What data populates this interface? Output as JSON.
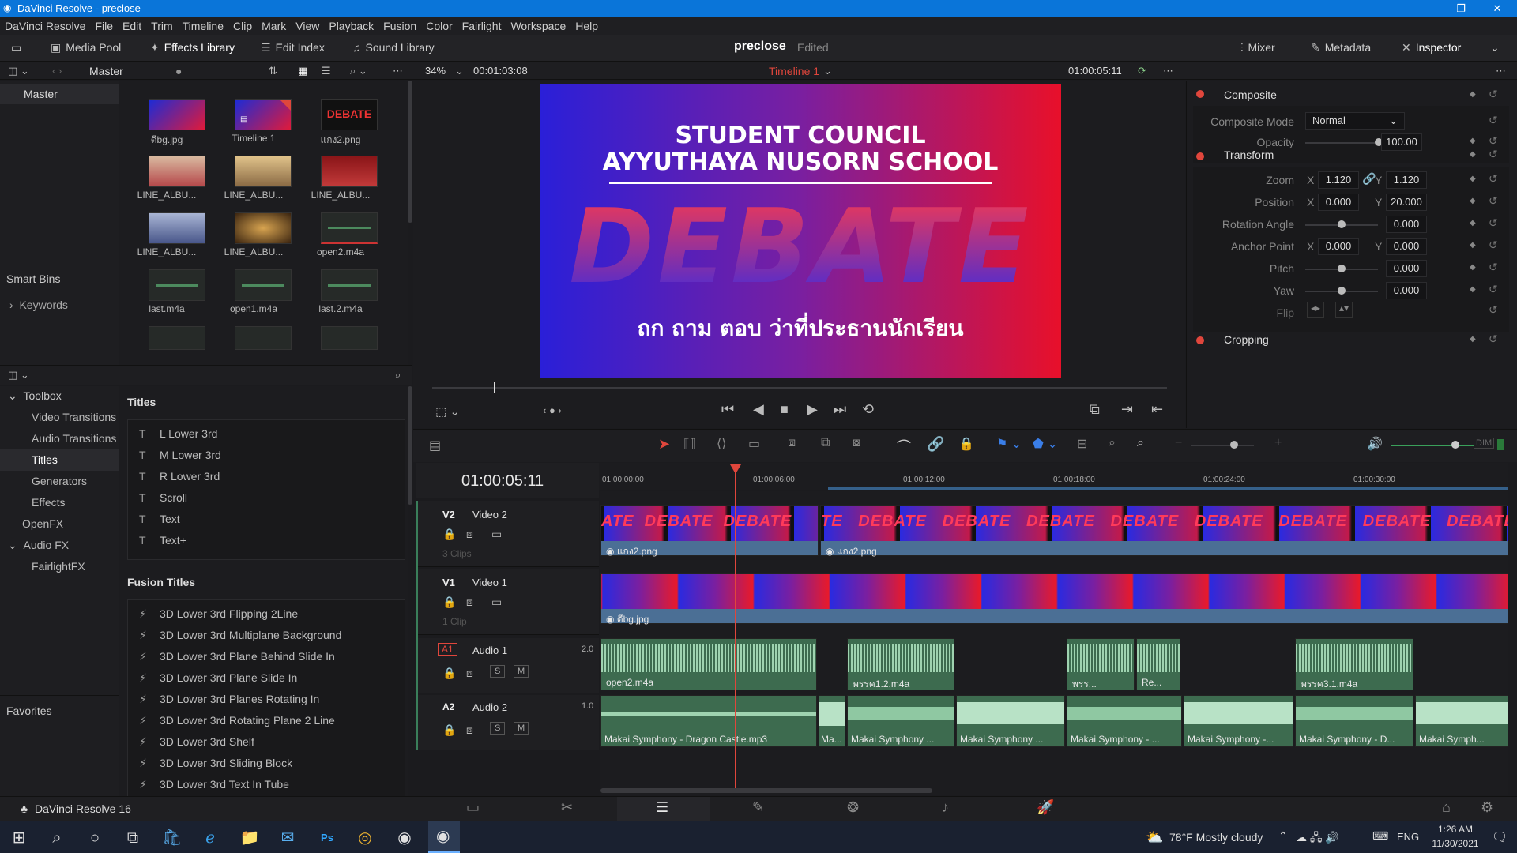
{
  "window": {
    "title": "DaVinci Resolve - preclose",
    "minimize": "—",
    "maximize": "❐",
    "close": "✕"
  },
  "menu": [
    "DaVinci Resolve",
    "File",
    "Edit",
    "Trim",
    "Timeline",
    "Clip",
    "Mark",
    "View",
    "Playback",
    "Fusion",
    "Color",
    "Fairlight",
    "Workspace",
    "Help"
  ],
  "toolbar": {
    "media_pool": "Media Pool",
    "effects_library": "Effects Library",
    "edit_index": "Edit Index",
    "sound_library": "Sound Library",
    "project_name": "preclose",
    "project_status": "Edited",
    "mixer": "Mixer",
    "metadata": "Metadata",
    "inspector": "Inspector"
  },
  "media_pool": {
    "bin": "Master",
    "tree_master": "Master",
    "smart_bins": "Smart Bins",
    "keywords": "Keywords",
    "clips": [
      {
        "name": "ดีbg.jpg"
      },
      {
        "name": "Timeline 1"
      },
      {
        "name": "แกง2.png"
      },
      {
        "name": "LINE_ALBU..."
      },
      {
        "name": "LINE_ALBU..."
      },
      {
        "name": "LINE_ALBU..."
      },
      {
        "name": "LINE_ALBU..."
      },
      {
        "name": "LINE_ALBU..."
      },
      {
        "name": "open2.m4a"
      },
      {
        "name": "last.m4a"
      },
      {
        "name": "open1.m4a"
      },
      {
        "name": "last.2.m4a"
      }
    ]
  },
  "effects": {
    "toolbox": "Toolbox",
    "tree": [
      "Video Transitions",
      "Audio Transitions",
      "Titles",
      "Generators",
      "Effects"
    ],
    "openfx": "OpenFX",
    "audiofx": "Audio FX",
    "fairlightfx": "FairlightFX",
    "favorites": "Favorites",
    "titles_header": "Titles",
    "titles": [
      "L Lower 3rd",
      "M Lower 3rd",
      "R Lower 3rd",
      "Scroll",
      "Text",
      "Text+"
    ],
    "fusion_header": "Fusion Titles",
    "fusion_titles": [
      "3D Lower 3rd Flipping 2Line",
      "3D Lower 3rd Multiplane Background",
      "3D Lower 3rd Plane Behind Slide In",
      "3D Lower 3rd Plane Slide In",
      "3D Lower 3rd Planes Rotating In",
      "3D Lower 3rd Rotating Plane 2 Line",
      "3D Lower 3rd Shelf",
      "3D Lower 3rd Sliding Block",
      "3D Lower 3rd Text In Tube"
    ]
  },
  "viewer": {
    "zoom": "34%",
    "duration": "00:01:03:08",
    "timeline_name": "Timeline 1",
    "timecode": "01:00:05:11",
    "poster_line1": "STUDENT COUNCIL",
    "poster_line2": "AYYUTHAYA NUSORN SCHOOL",
    "poster_title": "DEBATE",
    "poster_sub": "ถก ถาม ตอบ ว่าที่ประธานนักเรียน"
  },
  "inspector": {
    "composite": "Composite",
    "composite_mode_label": "Composite Mode",
    "composite_mode": "Normal",
    "opacity_label": "Opacity",
    "opacity": "100.00",
    "transform": "Transform",
    "zoom_label": "Zoom",
    "zoom_x": "1.120",
    "zoom_y": "1.120",
    "position_label": "Position",
    "pos_x": "0.000",
    "pos_y": "20.000",
    "rotation_label": "Rotation Angle",
    "rotation": "0.000",
    "anchor_label": "Anchor Point",
    "anchor_x": "0.000",
    "anchor_y": "0.000",
    "pitch_label": "Pitch",
    "pitch": "0.000",
    "yaw_label": "Yaw",
    "yaw": "0.000",
    "flip_label": "Flip",
    "cropping": "Cropping",
    "x": "X",
    "y": "Y"
  },
  "timeline": {
    "timecode": "01:00:05:11",
    "ruler": [
      "01:00:00:00",
      "01:00:06:00",
      "01:00:12:00",
      "01:00:18:00",
      "01:00:24:00",
      "01:00:30:00"
    ],
    "tracks": [
      {
        "id": "V2",
        "name": "Video 2",
        "count": "3 Clips"
      },
      {
        "id": "V1",
        "name": "Video 1",
        "count": "1 Clip"
      },
      {
        "id": "A1",
        "name": "Audio 1",
        "level": "2.0"
      },
      {
        "id": "A2",
        "name": "Audio 2",
        "level": "1.0"
      }
    ],
    "v2_clip_a": "แกง2.png",
    "v2_clip_b": "แกง2.png",
    "v1_clip": "ดีbg.jpg",
    "a1_clips": [
      "open2.m4a",
      "พรรค1.2.m4a",
      "พรร...",
      "Re...",
      "พรรค3.1.m4a"
    ],
    "a2_clips": [
      "Makai Symphony - Dragon Castle.mp3",
      "Ma...",
      "Makai Symphony ...",
      "Makai Symphony ...",
      "Makai Symphony - ...",
      "Makai Symphony -...",
      "Makai Symphony - D...",
      "Makai Symph..."
    ],
    "solo": "S",
    "mute": "M"
  },
  "footer": {
    "app_name": "DaVinci Resolve 16"
  },
  "taskbar": {
    "weather": "78°F  Mostly cloudy",
    "lang": "ENG",
    "time": "1:26 AM",
    "date": "11/30/2021"
  },
  "colors": {
    "accent": "#0a75d9",
    "playhead": "#e0463c",
    "video_clip": "#4b6f95",
    "audio_clip": "#3d6b4f"
  }
}
